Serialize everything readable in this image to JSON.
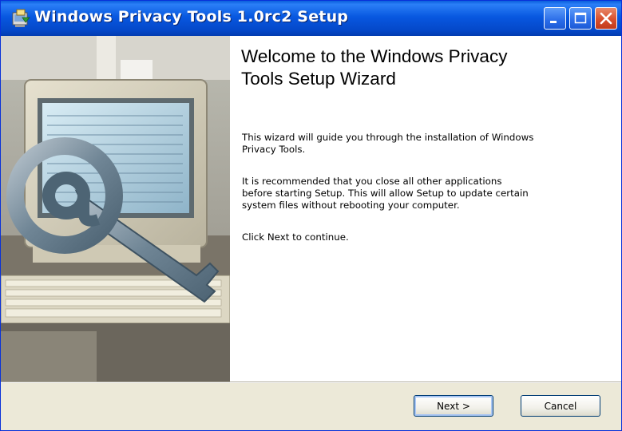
{
  "window": {
    "title": "Windows Privacy Tools 1.0rc2 Setup",
    "controls": [
      "minimize",
      "maximize",
      "close"
    ]
  },
  "welcome": {
    "heading_line1": "Welcome to the Windows Privacy",
    "heading_line2": "Tools Setup Wizard",
    "para1_line1": "This wizard will guide you through the installation of Windows",
    "para1_line2": "Privacy Tools.",
    "para2_line1": "It is recommended that you close all other applications",
    "para2_line2": "before starting Setup. This will allow Setup to update certain",
    "para2_line3": "system files without rebooting your computer.",
    "para3": "Click Next to continue."
  },
  "buttons": {
    "next": "Next >",
    "cancel": "Cancel"
  },
  "colors": {
    "titlebar": "#0858e0",
    "close_button": "#d8502e",
    "dialog_background": "#ece9d8",
    "default_button_focus": "#a9c6f3"
  },
  "icons": {
    "title": "installer-icon",
    "banner": "at-sign-key-computer-image"
  }
}
